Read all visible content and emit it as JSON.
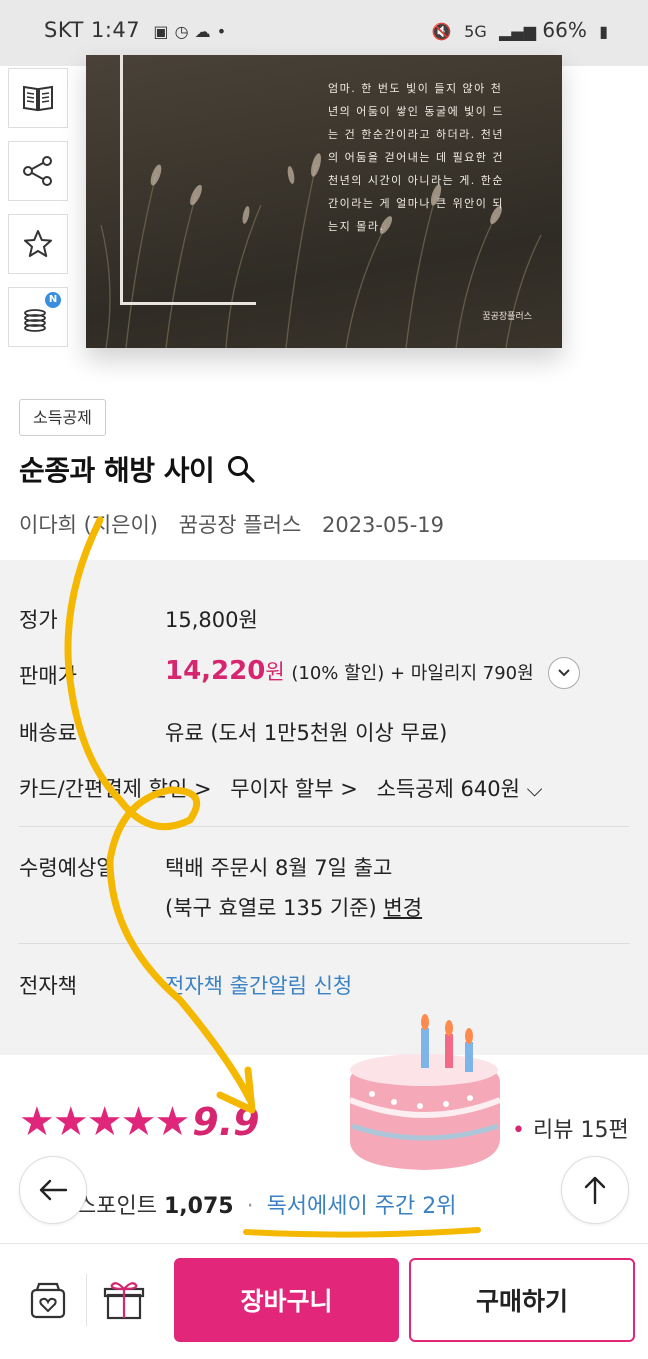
{
  "status_bar": {
    "carrier": "SKT",
    "time": "1:47",
    "net": "5G",
    "battery": "66%"
  },
  "side_tools": [
    {
      "icon": "book-preview-icon"
    },
    {
      "icon": "share-icon"
    },
    {
      "icon": "star-outline-icon"
    },
    {
      "icon": "coins-icon",
      "badge": "N"
    }
  ],
  "cover": {
    "text": "엄마. 한 번도 빛이 들지 않아 천\n년의 어둠이 쌓인 동굴에 빛이 드\n는 건 한순간이라고 하더라. 천년\n의 어둠을 걷어내는 데 필요한 건\n천년의 시간이 아니라는 게. 한순\n간이라는 게 얼마나 큰 위안이 되\n는지 몰라.",
    "publisher_mark": "꿈공장플러스"
  },
  "book": {
    "tag": "소득공제",
    "title": "순종과 해방 사이",
    "author": "이다희 (지은이)",
    "publisher": "꿈공장 플러스",
    "date": "2023-05-19"
  },
  "price": {
    "list_label": "정가",
    "list_price": "15,800원",
    "sale_label": "판매가",
    "sale_price": "14,220",
    "sale_unit": "원",
    "sale_extra": "(10% 할인) + 마일리지 790원",
    "shipping_label": "배송료",
    "shipping_value": "유료 (도서 1만5천원 이상 무료)",
    "card_discount": "카드/간편결제 할인",
    "installment": "무이자 할부",
    "tax_deduction": "소득공제 640원",
    "delivery_label": "수령예상일",
    "delivery_value": "택배 주문시 8월 7일 출고",
    "delivery_addr": "(북구 효열로 135 기준)",
    "delivery_change": "변경",
    "ebook_label": "전자책",
    "ebook_value": "전자책 출간알림 신청"
  },
  "rating": {
    "score": "9.9",
    "stars": 5,
    "review": "리뷰 15편",
    "sales_label": "스포인트",
    "sales_value": "1,075",
    "rank": "독서에세이 주간 2위"
  },
  "bottom": {
    "cart_label": "장바구니",
    "buy_label": "구매하기"
  },
  "colors": {
    "accent": "#e2267a",
    "link": "#3a82c4",
    "highlight": "#f5b800"
  }
}
